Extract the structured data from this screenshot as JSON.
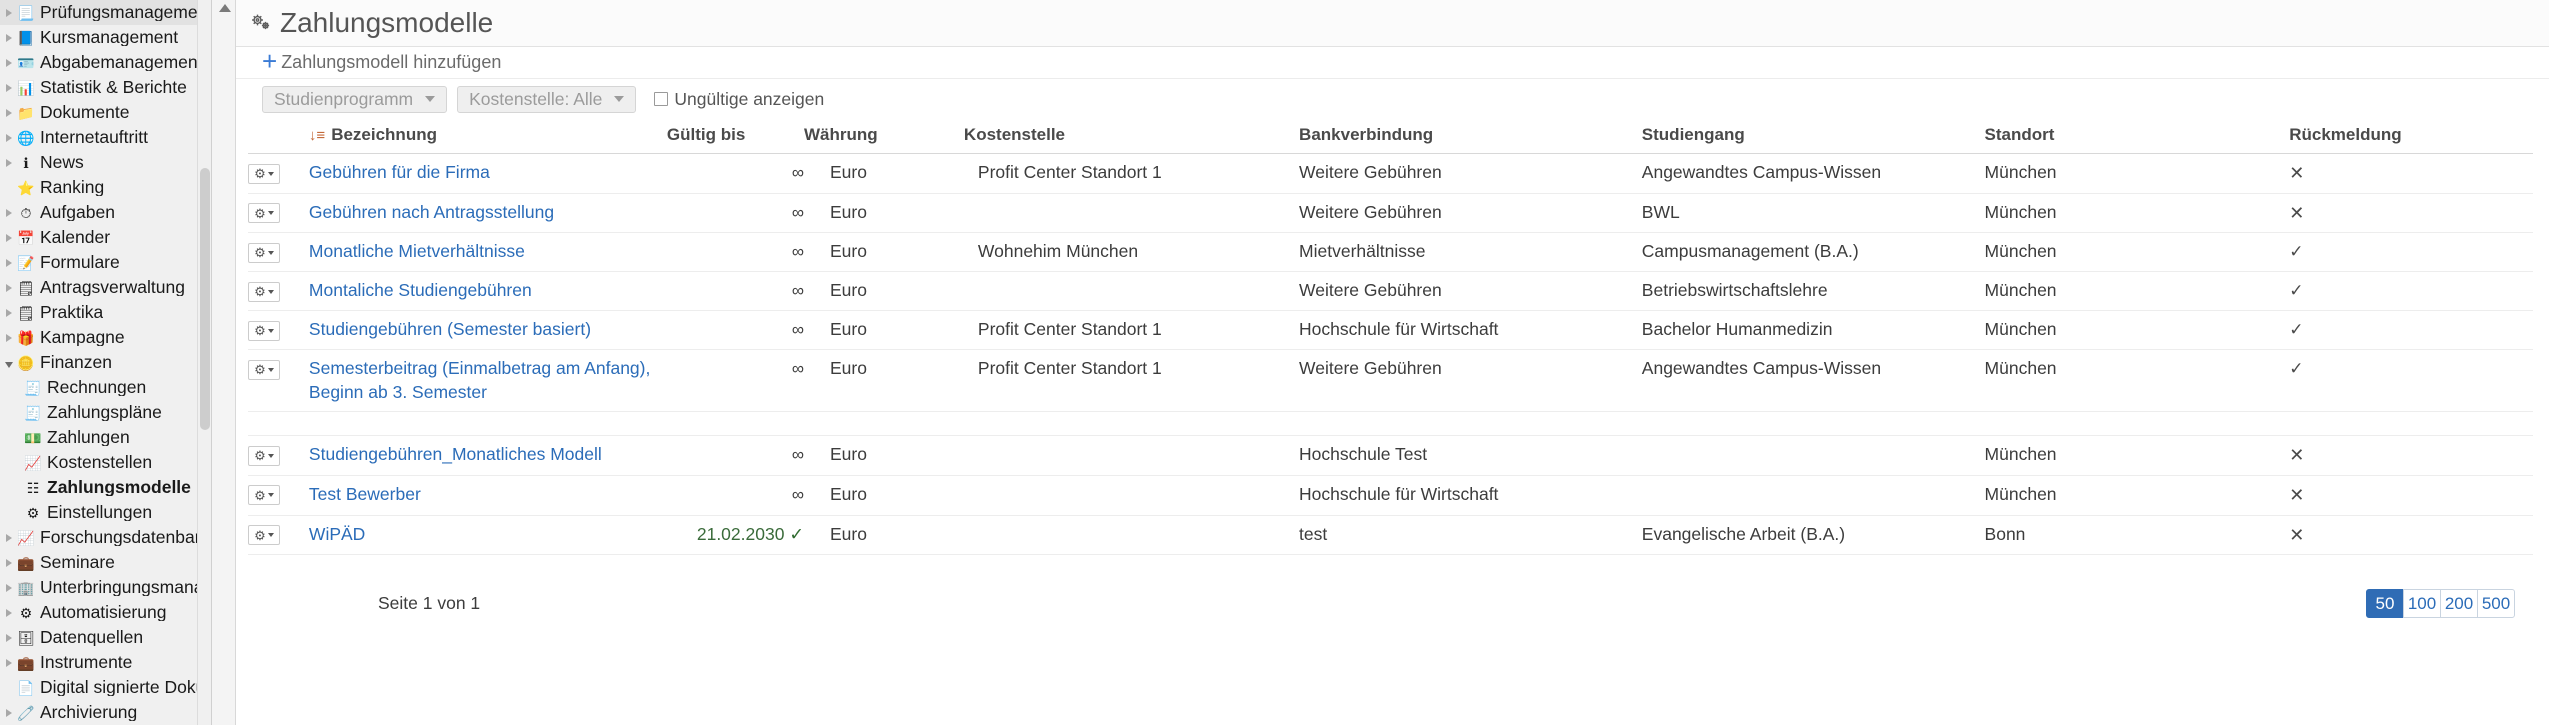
{
  "sidebar": {
    "items": [
      {
        "label": "Prüfungsmanagement",
        "icon": "exam-icon",
        "glyph": "📃",
        "expandable": true,
        "expanded": false,
        "child": false,
        "selected": false
      },
      {
        "label": "Kursmanagement",
        "icon": "book-icon",
        "glyph": "📘",
        "expandable": true,
        "expanded": false,
        "child": false,
        "selected": false
      },
      {
        "label": "Abgabemanagement",
        "icon": "id-card-icon",
        "glyph": "🪪",
        "expandable": true,
        "expanded": false,
        "child": false,
        "selected": false
      },
      {
        "label": "Statistik & Berichte",
        "icon": "bar-chart-icon",
        "glyph": "📊",
        "expandable": true,
        "expanded": false,
        "child": false,
        "selected": false
      },
      {
        "label": "Dokumente",
        "icon": "folder-icon",
        "glyph": "📁",
        "expandable": true,
        "expanded": false,
        "child": false,
        "selected": false
      },
      {
        "label": "Internetauftritt",
        "icon": "globe-icon",
        "glyph": "🌐",
        "expandable": true,
        "expanded": false,
        "child": false,
        "selected": false
      },
      {
        "label": "News",
        "icon": "info-icon",
        "glyph": "ℹ",
        "expandable": true,
        "expanded": false,
        "child": false,
        "selected": false
      },
      {
        "label": "Ranking",
        "icon": "star-medal-icon",
        "glyph": "⭐",
        "expandable": false,
        "expanded": false,
        "child": false,
        "selected": false
      },
      {
        "label": "Aufgaben",
        "icon": "clock-history-icon",
        "glyph": "⏱",
        "expandable": true,
        "expanded": false,
        "child": false,
        "selected": false
      },
      {
        "label": "Kalender",
        "icon": "calendar-icon",
        "glyph": "📅",
        "expandable": true,
        "expanded": false,
        "child": false,
        "selected": false
      },
      {
        "label": "Formulare",
        "icon": "form-icon",
        "glyph": "📝",
        "expandable": true,
        "expanded": false,
        "child": false,
        "selected": false
      },
      {
        "label": "Antragsverwaltung",
        "icon": "application-table-icon",
        "glyph": "🗒",
        "expandable": true,
        "expanded": false,
        "child": false,
        "selected": false
      },
      {
        "label": "Praktika",
        "icon": "internship-table-icon",
        "glyph": "🗒",
        "expandable": true,
        "expanded": false,
        "child": false,
        "selected": false
      },
      {
        "label": "Kampagne",
        "icon": "gift-icon",
        "glyph": "🎁",
        "expandable": true,
        "expanded": false,
        "child": false,
        "selected": false
      },
      {
        "label": "Finanzen",
        "icon": "coins-icon",
        "glyph": "🪙",
        "expandable": true,
        "expanded": true,
        "child": false,
        "selected": false
      },
      {
        "label": "Rechnungen",
        "icon": "invoice-search-icon",
        "glyph": "🧾",
        "expandable": false,
        "expanded": false,
        "child": true,
        "selected": false
      },
      {
        "label": "Zahlungspläne",
        "icon": "payment-plan-icon",
        "glyph": "🧾",
        "expandable": false,
        "expanded": false,
        "child": true,
        "selected": false
      },
      {
        "label": "Zahlungen",
        "icon": "banknote-icon",
        "glyph": "💵",
        "expandable": false,
        "expanded": false,
        "child": true,
        "selected": false
      },
      {
        "label": "Kostenstellen",
        "icon": "cost-center-chart-icon",
        "glyph": "📈",
        "expandable": false,
        "expanded": false,
        "child": true,
        "selected": false
      },
      {
        "label": "Zahlungsmodelle",
        "icon": "payment-models-icon",
        "glyph": "☷",
        "expandable": false,
        "expanded": false,
        "child": true,
        "selected": true
      },
      {
        "label": "Einstellungen",
        "icon": "gear-icon",
        "glyph": "⚙",
        "expandable": false,
        "expanded": false,
        "child": true,
        "selected": false
      },
      {
        "label": "Forschungsdatenbank",
        "icon": "research-chart-icon",
        "glyph": "📈",
        "expandable": true,
        "expanded": false,
        "child": false,
        "selected": false
      },
      {
        "label": "Seminare",
        "icon": "briefcase-icon",
        "glyph": "💼",
        "expandable": true,
        "expanded": false,
        "child": false,
        "selected": false
      },
      {
        "label": "Unterbringungsmanagement",
        "icon": "building-icon",
        "glyph": "🏢",
        "expandable": true,
        "expanded": false,
        "child": false,
        "selected": false
      },
      {
        "label": "Automatisierung",
        "icon": "gear-icon",
        "glyph": "⚙",
        "expandable": true,
        "expanded": false,
        "child": false,
        "selected": false
      },
      {
        "label": "Datenquellen",
        "icon": "database-icon",
        "glyph": "🗄",
        "expandable": true,
        "expanded": false,
        "child": false,
        "selected": false
      },
      {
        "label": "Instrumente",
        "icon": "wallet-icon",
        "glyph": "💼",
        "expandable": true,
        "expanded": false,
        "child": false,
        "selected": false
      },
      {
        "label": "Digital signierte Dokumente",
        "icon": "signed-document-icon",
        "glyph": "📄",
        "expandable": false,
        "expanded": false,
        "child": false,
        "selected": false
      },
      {
        "label": "Archivierung",
        "icon": "archive-card-icon",
        "glyph": "🧷",
        "expandable": true,
        "expanded": false,
        "child": false,
        "selected": false
      }
    ]
  },
  "header": {
    "title": "Zahlungsmodelle",
    "icon": "gears-icon"
  },
  "toolbar": {
    "add_label": "Zahlungsmodell hinzufügen",
    "add_plus": "+",
    "filter_studienprogramm": "Studienprogramm",
    "filter_kostenstelle": "Kostenstelle: Alle",
    "checkbox_label": "Ungültige anzeigen",
    "checkbox_checked": false
  },
  "table": {
    "sort_indicator": "↓≡",
    "columns": [
      "Bezeichnung",
      "Gültig bis",
      "Währung",
      "Kostenstelle",
      "Bankverbindung",
      "Studiengang",
      "Standort",
      "Rückmeldung"
    ],
    "rows": [
      {
        "name": "Gebühren für die Firma",
        "gueltig_bis": "∞",
        "waehrung": "Euro",
        "kostenstelle": "Profit Center Standort 1",
        "bankverbindung": "Weitere Gebühren",
        "studiengang": "Angewandtes Campus-Wissen",
        "standort": "München",
        "rueckmeldung": "✕",
        "date_valid": false
      },
      {
        "name": "Gebühren nach Antragsstellung",
        "gueltig_bis": "∞",
        "waehrung": "Euro",
        "kostenstelle": "",
        "bankverbindung": "Weitere Gebühren",
        "studiengang": "BWL",
        "standort": "München",
        "rueckmeldung": "✕",
        "date_valid": false
      },
      {
        "name": "Monatliche Mietverhältnisse",
        "gueltig_bis": "∞",
        "waehrung": "Euro",
        "kostenstelle": "Wohnehim München",
        "bankverbindung": "Mietverhältnisse",
        "studiengang": "Campusmanagement (B.A.)",
        "standort": "München",
        "rueckmeldung": "✓",
        "date_valid": false
      },
      {
        "name": "Montaliche Studiengebühren",
        "gueltig_bis": "∞",
        "waehrung": "Euro",
        "kostenstelle": "",
        "bankverbindung": "Weitere Gebühren",
        "studiengang": "Betriebswirtschaftslehre",
        "standort": "München",
        "rueckmeldung": "✓",
        "date_valid": false
      },
      {
        "name": "Studiengebühren (Semester basiert)",
        "gueltig_bis": "∞",
        "waehrung": "Euro",
        "kostenstelle": "Profit Center Standort 1",
        "bankverbindung": "Hochschule für Wirtschaft",
        "studiengang": "Bachelor Humanmedizin",
        "standort": "München",
        "rueckmeldung": "✓",
        "date_valid": false
      },
      {
        "name": "Semesterbeitrag (Einmalbetrag am Anfang), Beginn ab 3. Semester",
        "gueltig_bis": "∞",
        "waehrung": "Euro",
        "kostenstelle": "Profit Center Standort 1",
        "bankverbindung": "Weitere Gebühren",
        "studiengang": "Angewandtes Campus-Wissen",
        "standort": "München",
        "rueckmeldung": "✓",
        "date_valid": false
      },
      {
        "name": "Studiengebühren_Monatliches Modell",
        "gueltig_bis": "∞",
        "waehrung": "Euro",
        "kostenstelle": "",
        "bankverbindung": "Hochschule Test",
        "studiengang": "",
        "standort": "München",
        "rueckmeldung": "✕",
        "date_valid": false
      },
      {
        "name": "Test Bewerber",
        "gueltig_bis": "∞",
        "waehrung": "Euro",
        "kostenstelle": "",
        "bankverbindung": "Hochschule für Wirtschaft",
        "studiengang": "",
        "standort": "München",
        "rueckmeldung": "✕",
        "date_valid": false
      },
      {
        "name": "WiPÄD",
        "gueltig_bis": "21.02.2030",
        "waehrung": "Euro",
        "kostenstelle": "",
        "bankverbindung": "test",
        "studiengang": "Evangelische Arbeit (B.A.)",
        "standort": "Bonn",
        "rueckmeldung": "✕",
        "date_valid": true
      }
    ]
  },
  "pagination": {
    "page_info": "Seite 1 von 1",
    "sizes": [
      "50",
      "100",
      "200",
      "500"
    ],
    "active_size": "50"
  },
  "colors": {
    "accent": "#2f6cb5",
    "link": "#2b6cb8",
    "sidebar_bg": "#f0f0f0"
  }
}
